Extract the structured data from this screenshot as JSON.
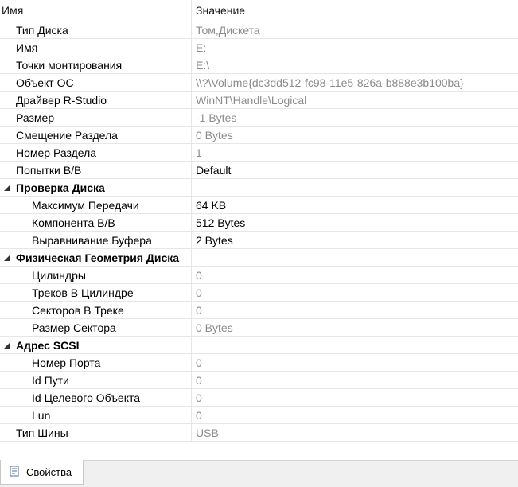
{
  "header": {
    "name_label": "Имя",
    "value_label": "Значение"
  },
  "rows": [
    {
      "name": "Тип Диска",
      "value": "Том,Дискета"
    },
    {
      "name": "Имя",
      "value": "E:"
    },
    {
      "name": "Точки монтирования",
      "value": "E:\\"
    },
    {
      "name": "Объект ОС",
      "value": "\\\\?\\Volume{dc3dd512-fc98-11e5-826a-b888e3b100ba}"
    },
    {
      "name": "Драйвер R-Studio",
      "value": "WinNT\\Handle\\Logical"
    },
    {
      "name": "Размер",
      "value": "-1 Bytes"
    },
    {
      "name": "Смещение Раздела",
      "value": "0 Bytes"
    },
    {
      "name": "Номер Раздела",
      "value": "1"
    },
    {
      "name": "Попытки В/В",
      "value": "Default"
    },
    {
      "name": "Проверка Диска",
      "value": ""
    },
    {
      "name": "Максимум Передачи",
      "value": "64 KB"
    },
    {
      "name": "Компонента В/В",
      "value": "512 Bytes"
    },
    {
      "name": "Выравнивание Буфера",
      "value": "2 Bytes"
    },
    {
      "name": "Физическая Геометрия Диска",
      "value": ""
    },
    {
      "name": "Цилиндры",
      "value": "0"
    },
    {
      "name": "Треков В Цилиндре",
      "value": "0"
    },
    {
      "name": "Секторов В Треке",
      "value": "0"
    },
    {
      "name": "Размер Сектора",
      "value": "0 Bytes"
    },
    {
      "name": "Адрес SCSI",
      "value": ""
    },
    {
      "name": "Номер Порта",
      "value": "0"
    },
    {
      "name": "Id Пути",
      "value": "0"
    },
    {
      "name": "Id Целевого Объекта",
      "value": "0"
    },
    {
      "name": "Lun",
      "value": "0"
    },
    {
      "name": "Тип Шины",
      "value": "USB"
    }
  ],
  "statusbar": {
    "tab_label": "Свойства",
    "tab_icon": "properties-icon"
  },
  "colors": {
    "readonly_text": "#8c8c8c",
    "editable_text": "#000000",
    "grid_line": "#e6e6e6"
  }
}
